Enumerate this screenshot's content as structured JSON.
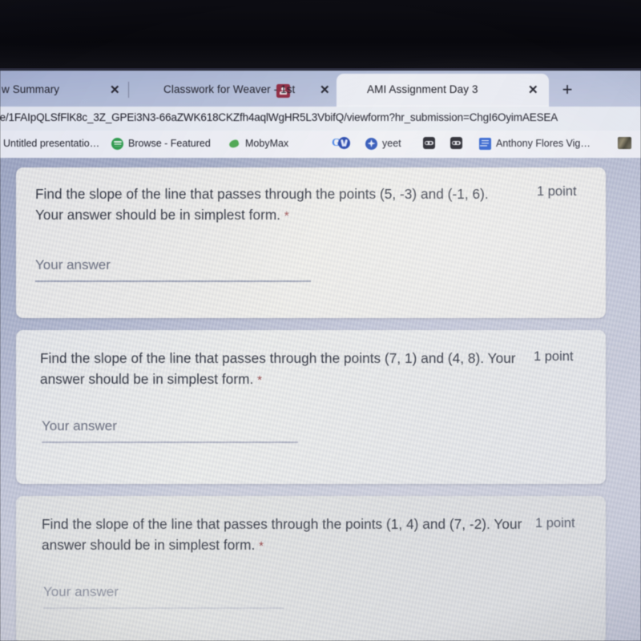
{
  "browser": {
    "tabs": [
      {
        "title": "w Summary",
        "icon": "none",
        "active": false,
        "close_label": "✕"
      },
      {
        "title": "Classwork for Weaver - 1st",
        "icon": "google-classroom-icon",
        "active": false,
        "close_label": "✕"
      },
      {
        "title": "AMI Assignment Day 3",
        "icon": "google-forms-icon",
        "active": true,
        "close_label": "✕"
      }
    ],
    "new_tab_label": "+",
    "url": "/e/1FAIpQLSfFlK8c_3Z_GPEi3N3-66aZWK618CKZfh4aqlWgHR5L3VbifQ/viewform?hr_submission=ChgI6OyimAESEA",
    "bookmarks": [
      {
        "label": "Untitled presentatio…",
        "icon": "none"
      },
      {
        "label": "Browse - Featured",
        "icon": "spotify-icon"
      },
      {
        "label": "MobyMax",
        "icon": "mobymax-icon"
      },
      {
        "label": "",
        "icon": "google-icon"
      },
      {
        "label": "",
        "icon": "blue-circle-icon"
      },
      {
        "label": "yeet",
        "icon": "blue-star-icon"
      },
      {
        "label": "",
        "icon": "dark-goggles-icon"
      },
      {
        "label": "",
        "icon": "dark-goggles-icon"
      },
      {
        "label": "Anthony Flores Vig…",
        "icon": "google-docs-icon"
      },
      {
        "label": "",
        "icon": "photo-thumbnail-icon"
      }
    ]
  },
  "form": {
    "questions": [
      {
        "text": "Find the slope of the line that passes through the points (5, -3) and (-1, 6). Your answer should be in simplest form.",
        "required_marker": "*",
        "points": "1 point",
        "answer_placeholder": "Your answer",
        "answer_value": ""
      },
      {
        "text": "Find the slope of the line that passes through the points (7, 1) and (4, 8). Your answer should be in simplest form.",
        "required_marker": "*",
        "points": "1 point",
        "answer_placeholder": "Your answer",
        "answer_value": ""
      },
      {
        "text": "Find the slope of the line that passes through the points (1, 4) and (7, -2). Your answer should be in simplest form.",
        "required_marker": "*",
        "points": "1 point",
        "answer_placeholder": "Your answer",
        "answer_value": ""
      }
    ]
  },
  "colors": {
    "forms_purple": "#3b32b5",
    "classroom_maroon": "#9b2b45",
    "required_red": "#9b3a3a",
    "page_background": "#c5c9dd",
    "card_background": "#f4f3ee"
  }
}
